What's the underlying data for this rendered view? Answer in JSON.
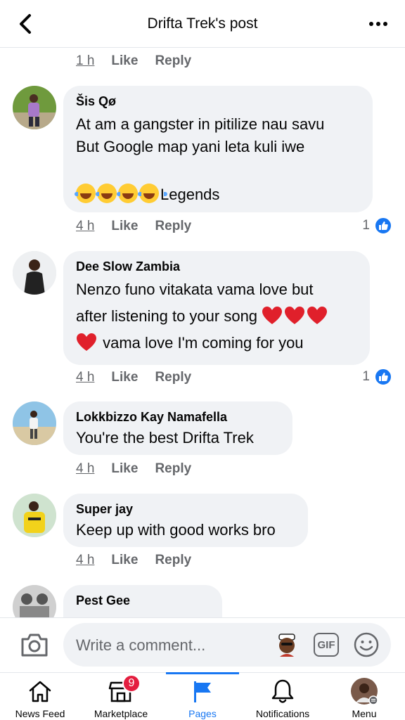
{
  "header": {
    "title": "Drifta Trek's post"
  },
  "top_meta": {
    "time": "1 h",
    "like": "Like",
    "reply": "Reply"
  },
  "comments": [
    {
      "name": "Šis Qø",
      "lines": [
        "At  am a gangster in pitilize nau savu",
        "But  Google map yani leta  kuli iwe"
      ],
      "emoji_line_text": "Legends",
      "time": "4 h",
      "like": "Like",
      "reply": "Reply",
      "reaction_count": "1"
    },
    {
      "name": "Dee Slow Zambia",
      "line1": "Nenzo funo vitakata vama love but",
      "line2": "after listening to your song",
      "line3": "vama love I'm coming for you",
      "time": "4 h",
      "like": "Like",
      "reply": "Reply",
      "reaction_count": "1"
    },
    {
      "name": "Lokkbizzo Kay Namafella",
      "text": "You're the best Drifta Trek",
      "time": "4 h",
      "like": "Like",
      "reply": "Reply"
    },
    {
      "name": "Super jay",
      "text": "Keep up with good works bro",
      "time": "4 h",
      "like": "Like",
      "reply": "Reply"
    },
    {
      "name": "Pest Gee"
    }
  ],
  "composer": {
    "placeholder": "Write a comment...",
    "gif_label": "GIF"
  },
  "tabs": [
    {
      "label": "News Feed"
    },
    {
      "label": "Marketplace",
      "badge": "9"
    },
    {
      "label": "Pages"
    },
    {
      "label": "Notifications"
    },
    {
      "label": "Menu"
    }
  ],
  "colors": {
    "accent": "#1877f2",
    "badge": "#e41e3f",
    "bubble": "#f0f2f5",
    "muted": "#65676b"
  },
  "icons": [
    "back-arrow-icon",
    "more-icon",
    "like-badge-icon",
    "camera-icon",
    "gif-icon",
    "emoji-icon",
    "home-icon",
    "marketplace-icon",
    "flag-icon",
    "bell-icon",
    "menu-avatar-icon"
  ]
}
